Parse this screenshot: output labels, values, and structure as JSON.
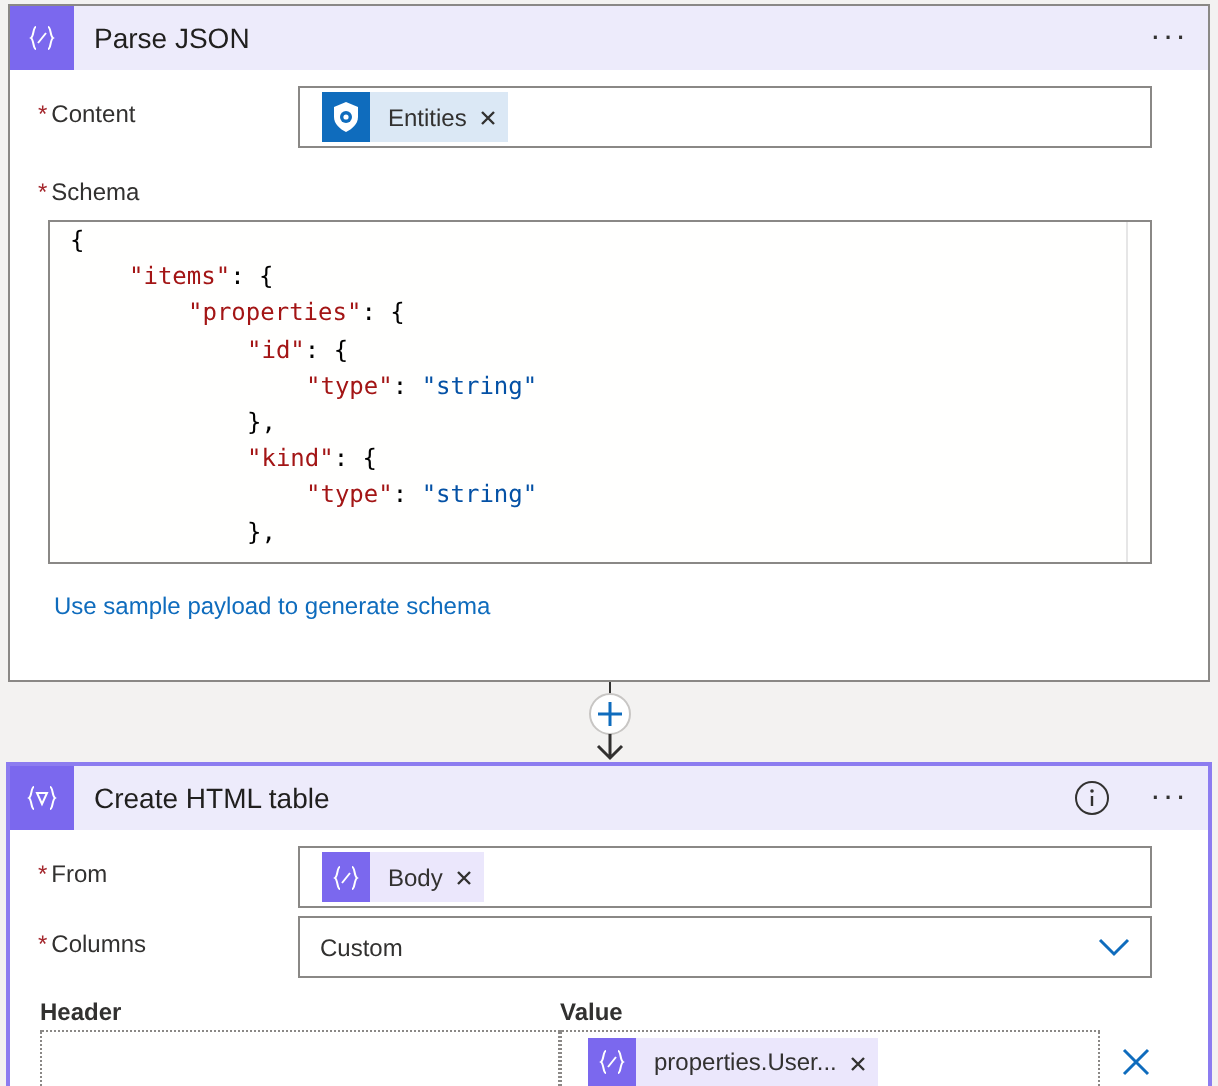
{
  "parse_json": {
    "title": "Parse JSON",
    "menu": "···",
    "fields": [
      {
        "label": "Content",
        "required_mark": "*",
        "token": {
          "kind": "shield",
          "text": "Entities"
        }
      }
    ],
    "schema": {
      "label": "Schema",
      "required_mark": "*",
      "code": [
        {
          "tokens": [
            {
              "kind": "punct",
              "text": "{"
            }
          ],
          "children": [
            {
              "tokens": [
                {
                  "kind": "key",
                  "text": "\"items\""
                },
                {
                  "kind": "punct",
                  "text": ": {"
                }
              ],
              "children": [
                {
                  "tokens": [
                    {
                      "kind": "key",
                      "text": "\"properties\""
                    },
                    {
                      "kind": "punct",
                      "text": ": {"
                    }
                  ],
                  "children": [
                    {
                      "tokens": [
                        {
                          "kind": "key",
                          "text": "\"id\""
                        },
                        {
                          "kind": "punct",
                          "text": ": {"
                        }
                      ],
                      "children": [
                        {
                          "tokens": [
                            {
                              "kind": "key",
                              "text": "\"type\""
                            },
                            {
                              "kind": "punct",
                              "text": ": "
                            },
                            {
                              "kind": "string",
                              "text": "\"string\""
                            }
                          ]
                        }
                      ]
                    },
                    {
                      "tokens": [
                        {
                          "kind": "punct",
                          "text": "},"
                        }
                      ]
                    },
                    {
                      "tokens": [
                        {
                          "kind": "key",
                          "text": "\"kind\""
                        },
                        {
                          "kind": "punct",
                          "text": ": {"
                        }
                      ],
                      "children": [
                        {
                          "tokens": [
                            {
                              "kind": "key",
                              "text": "\"type\""
                            },
                            {
                              "kind": "punct",
                              "text": ": "
                            },
                            {
                              "kind": "string",
                              "text": "\"string\""
                            }
                          ]
                        }
                      ]
                    },
                    {
                      "tokens": [
                        {
                          "kind": "punct",
                          "text": "},"
                        }
                      ]
                    }
                  ]
                }
              ]
            }
          ]
        }
      ]
    },
    "link": "Use sample payload to generate schema"
  },
  "create_table": {
    "title": "Create HTML table",
    "menu": "···",
    "fields": [
      {
        "label": "From",
        "required_mark": "*",
        "token": {
          "kind": "expression",
          "text": "Body"
        }
      }
    ],
    "columns": {
      "label": "Columns",
      "required_mark": "*",
      "value": "Custom"
    },
    "header_label": "Header",
    "value_label": "Value",
    "rows": [
      {
        "value_token": {
          "kind": "expression",
          "text": "properties.User..."
        }
      }
    ]
  }
}
